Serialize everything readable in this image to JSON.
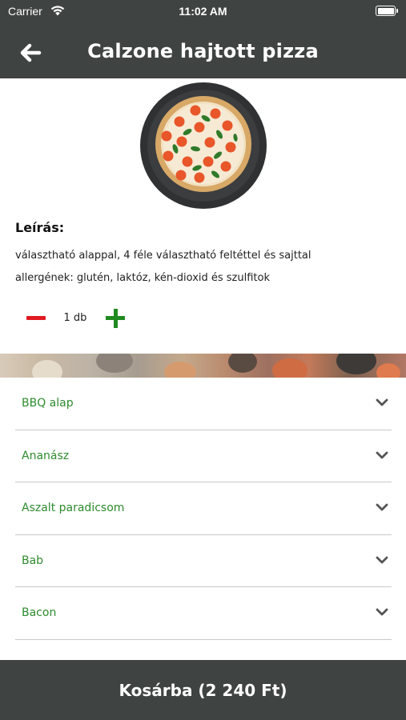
{
  "status_bar": {
    "carrier": "Carrier",
    "time": "11:02 AM"
  },
  "header": {
    "title": "Calzone hajtott pizza",
    "back_icon": "arrow-left-icon"
  },
  "product": {
    "image": "pizza-photo",
    "description_heading": "Leírás:",
    "description_lines": [
      "választható alappal, 4 féle választható feltéttel és sajttal",
      "allergének: glutén, laktóz, kén-dioxid és szulfitok"
    ]
  },
  "quantity": {
    "value": "1 db",
    "minus_icon": "minus-icon",
    "plus_icon": "plus-icon"
  },
  "options": [
    {
      "label": "BBQ alap"
    },
    {
      "label": "Ananász"
    },
    {
      "label": "Aszalt paradicsom"
    },
    {
      "label": "Bab"
    },
    {
      "label": "Bacon"
    }
  ],
  "cart": {
    "label": "Kosárba (2 240 Ft)"
  },
  "colors": {
    "header_bg": "#3f4442",
    "accent_green": "#2e8b2e",
    "minus_red": "#e01a22",
    "plus_green": "#1f8a1f"
  }
}
